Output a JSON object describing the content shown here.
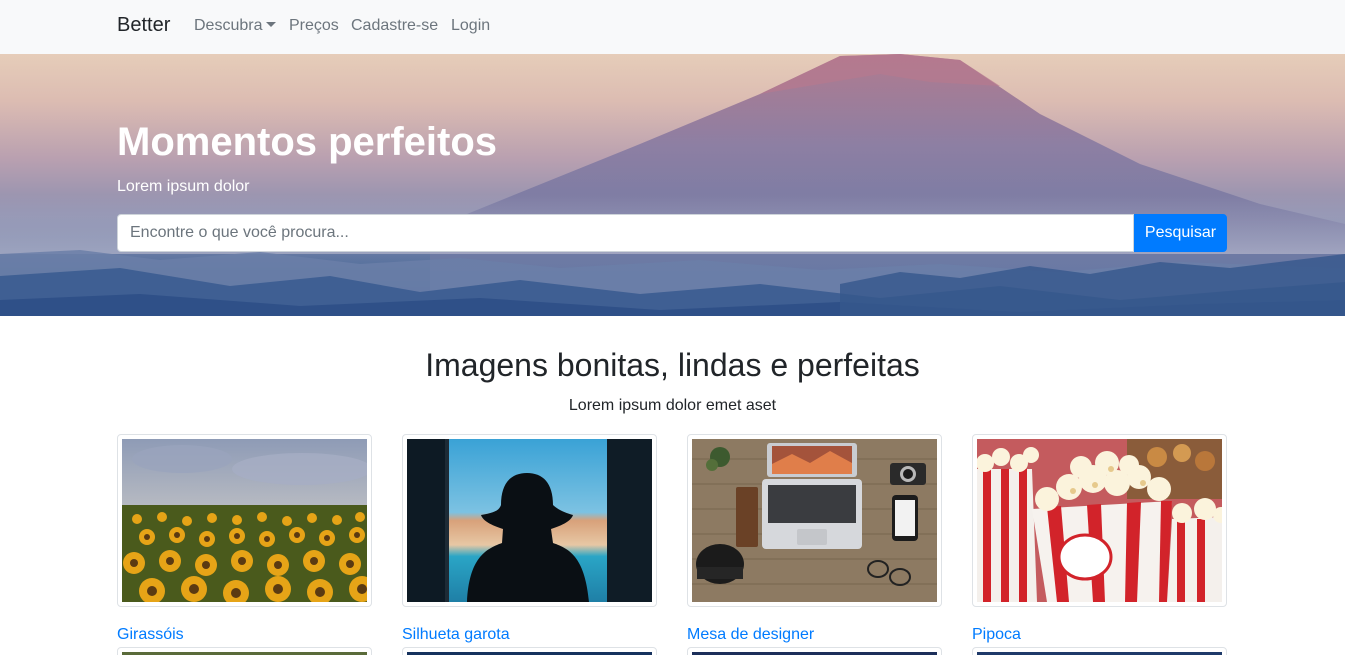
{
  "navbar": {
    "brand": "Better",
    "links": [
      {
        "label": "Descubra",
        "dropdown": true
      },
      {
        "label": "Preços"
      },
      {
        "label": "Cadastre-se"
      },
      {
        "label": "Login"
      }
    ]
  },
  "hero": {
    "title": "Momentos perfeitos",
    "subtitle": "Lorem ipsum dolor",
    "search": {
      "placeholder": "Encontre o que você procura...",
      "value": "",
      "button_label": "Pesquisar"
    }
  },
  "gallery": {
    "title": "Imagens bonitas, lindas e perfeitas",
    "subtitle": "Lorem ipsum dolor emet aset",
    "items": [
      {
        "caption": "Girassóis",
        "image": "sunflowers-image"
      },
      {
        "caption": "Silhueta garota",
        "image": "girl-silhouette-image"
      },
      {
        "caption": "Mesa de designer",
        "image": "designer-desk-image"
      },
      {
        "caption": "Pipoca",
        "image": "popcorn-image"
      }
    ]
  },
  "colors": {
    "primary": "#007bff",
    "navbar_bg": "#f8f9fa",
    "text": "#212529",
    "muted": "#6c757d"
  }
}
